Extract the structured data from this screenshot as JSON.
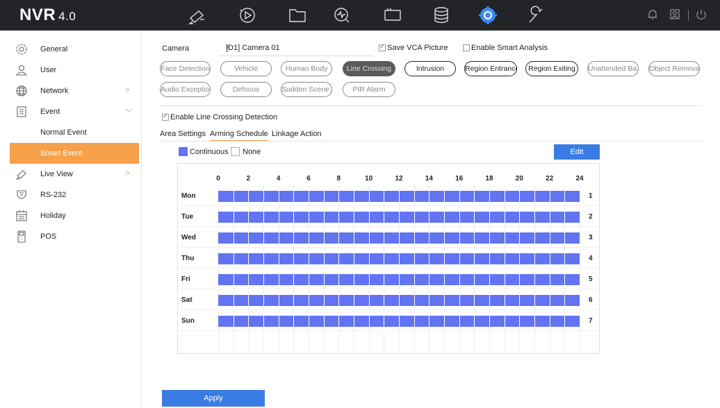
{
  "app": {
    "logo": "NVR",
    "version": "4.0"
  },
  "topnav": [
    "camera-icon",
    "playback-icon",
    "folder-icon",
    "search-icon",
    "storage-icon",
    "database-icon",
    "settings-icon",
    "maintenance-icon"
  ],
  "colors": {
    "accent": "#f6a04a",
    "schedule": "#6274f2",
    "button": "#3b7be4",
    "topbar": "#222428"
  },
  "sidebar": {
    "items": [
      {
        "label": "General",
        "icon": "gear-icon"
      },
      {
        "label": "User",
        "icon": "user-icon"
      },
      {
        "label": "Network",
        "icon": "globe-icon",
        "arrow": ">"
      },
      {
        "label": "Event",
        "icon": "event-doc-icon",
        "arrow": "﹀"
      },
      {
        "label": "Normal Event"
      },
      {
        "label": "Smart Event"
      },
      {
        "label": "Live View",
        "icon": "camera-icon",
        "arrow": ">"
      },
      {
        "label": "RS-232",
        "icon": "rs232-icon"
      },
      {
        "label": "Holiday",
        "icon": "calendar-icon"
      },
      {
        "label": "POS",
        "icon": "pos-icon"
      }
    ]
  },
  "camera": {
    "label": "Camera",
    "value": "[D1] Camera 01",
    "save_vca": "Save VCA Picture",
    "smart_analysis": "Enable Smart Analysis"
  },
  "pills": [
    "Face Detection",
    "Vehicle",
    "Human Body",
    "Line Crossing",
    "Intrusion",
    "Region Entrance",
    "Region Exiting",
    "Unattended Ba...",
    "Object Removal",
    "Audio Exception",
    "Defocus",
    "Sudden Scene...",
    "PIR Alarm"
  ],
  "enable_line": "Enable Line Crossing Detection",
  "tabs": [
    "Area Settings",
    "Arming Schedule",
    "Linkage Action"
  ],
  "legend": {
    "continuous": "Continuous",
    "none": "None"
  },
  "edit": "Edit",
  "schedule": {
    "hours": [
      "0",
      "2",
      "4",
      "6",
      "8",
      "10",
      "12",
      "14",
      "16",
      "18",
      "20",
      "22",
      "24"
    ],
    "days": [
      "Mon",
      "Tue",
      "Wed",
      "Thu",
      "Fri",
      "Sat",
      "Sun"
    ],
    "day_numbers": [
      "1",
      "2",
      "3",
      "4",
      "5",
      "6",
      "7"
    ]
  },
  "apply": "Apply"
}
